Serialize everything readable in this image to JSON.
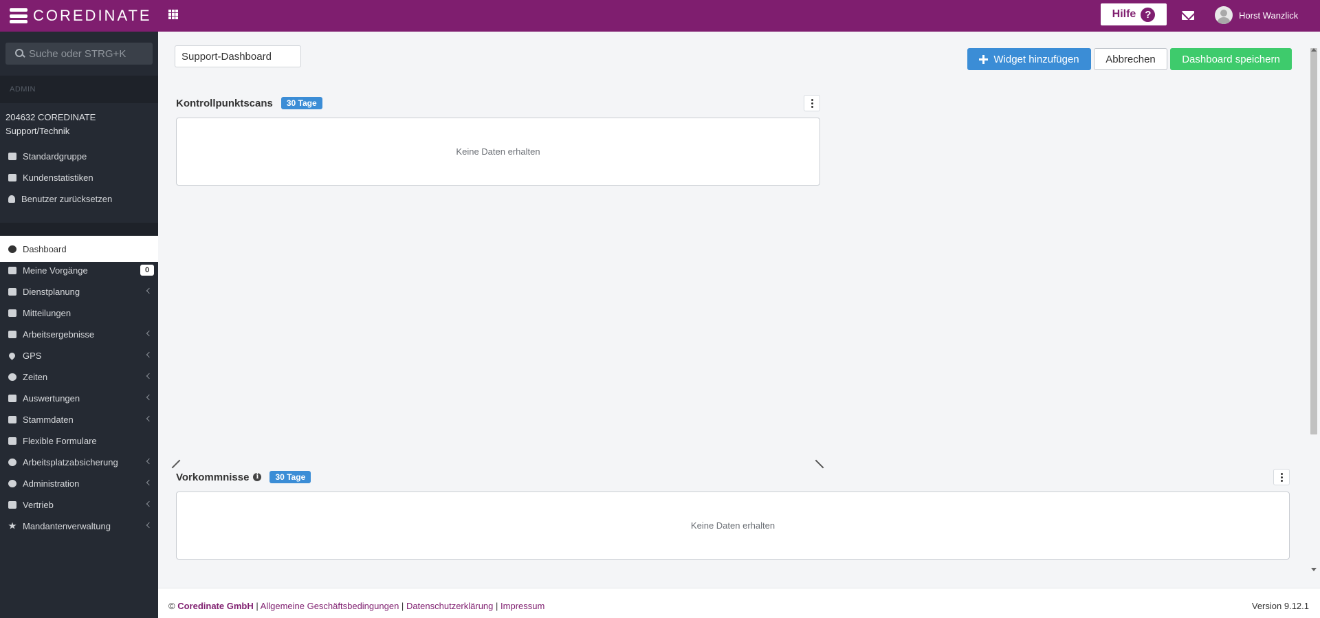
{
  "app": {
    "logo_text": "COREDINATE",
    "help_label": "Hilfe",
    "help_icon_glyph": "?",
    "user_name": "Horst Wanzlick",
    "brand_color": "#7f1e6f"
  },
  "sidebar": {
    "search_placeholder": "Suche oder STRG+K",
    "section_label": "ADMIN",
    "company_line1": "204632 COREDINATE",
    "company_line2": "Support/Technik",
    "admin_items": [
      {
        "label": "Standardgruppe",
        "icon": "external-link-icon"
      },
      {
        "label": "Kundenstatistiken",
        "icon": "bar-chart-icon"
      },
      {
        "label": "Benutzer zurücksetzen",
        "icon": "user-icon"
      }
    ],
    "nav_items": [
      {
        "label": "Dashboard",
        "icon": "dashboard-icon",
        "active": true
      },
      {
        "label": "Meine Vorgänge",
        "icon": "list-icon",
        "badge": "0"
      },
      {
        "label": "Dienstplanung",
        "icon": "calendar-list-icon",
        "expandable": true
      },
      {
        "label": "Mitteilungen",
        "icon": "envelope-icon"
      },
      {
        "label": "Arbeitsergebnisse",
        "icon": "monitor-icon",
        "expandable": true
      },
      {
        "label": "GPS",
        "icon": "map-pin-icon",
        "expandable": true
      },
      {
        "label": "Zeiten",
        "icon": "clock-icon",
        "expandable": true
      },
      {
        "label": "Auswertungen",
        "icon": "report-icon",
        "expandable": true
      },
      {
        "label": "Stammdaten",
        "icon": "book-icon",
        "expandable": true
      },
      {
        "label": "Flexible Formulare",
        "icon": "form-icon"
      },
      {
        "label": "Arbeitsplatzabsicherung",
        "icon": "globe-icon",
        "expandable": true
      },
      {
        "label": "Administration",
        "icon": "cogs-icon",
        "expandable": true
      },
      {
        "label": "Vertrieb",
        "icon": "money-icon",
        "expandable": true
      },
      {
        "label": "Mandantenverwaltung",
        "icon": "star-icon",
        "expandable": true
      }
    ]
  },
  "toolbar": {
    "dashboard_name": "Support-Dashboard",
    "add_widget_label": "Widget hinzufügen",
    "cancel_label": "Abbrechen",
    "save_label": "Dashboard speichern"
  },
  "widgets": [
    {
      "title": "Kontrollpunktscans",
      "period": "30 Tage",
      "empty_text": "Keine Daten erhalten"
    },
    {
      "title": "Vorkommnisse",
      "period": "30 Tage",
      "empty_text": "Keine Daten erhalten"
    }
  ],
  "footer": {
    "copyright": "©",
    "company": "Coredinate GmbH",
    "sep": "|",
    "links": [
      "Allgemeine Geschäftsbedingungen",
      "Datenschutzerklärung",
      "Impressum"
    ],
    "version": "Version 9.12.1"
  }
}
